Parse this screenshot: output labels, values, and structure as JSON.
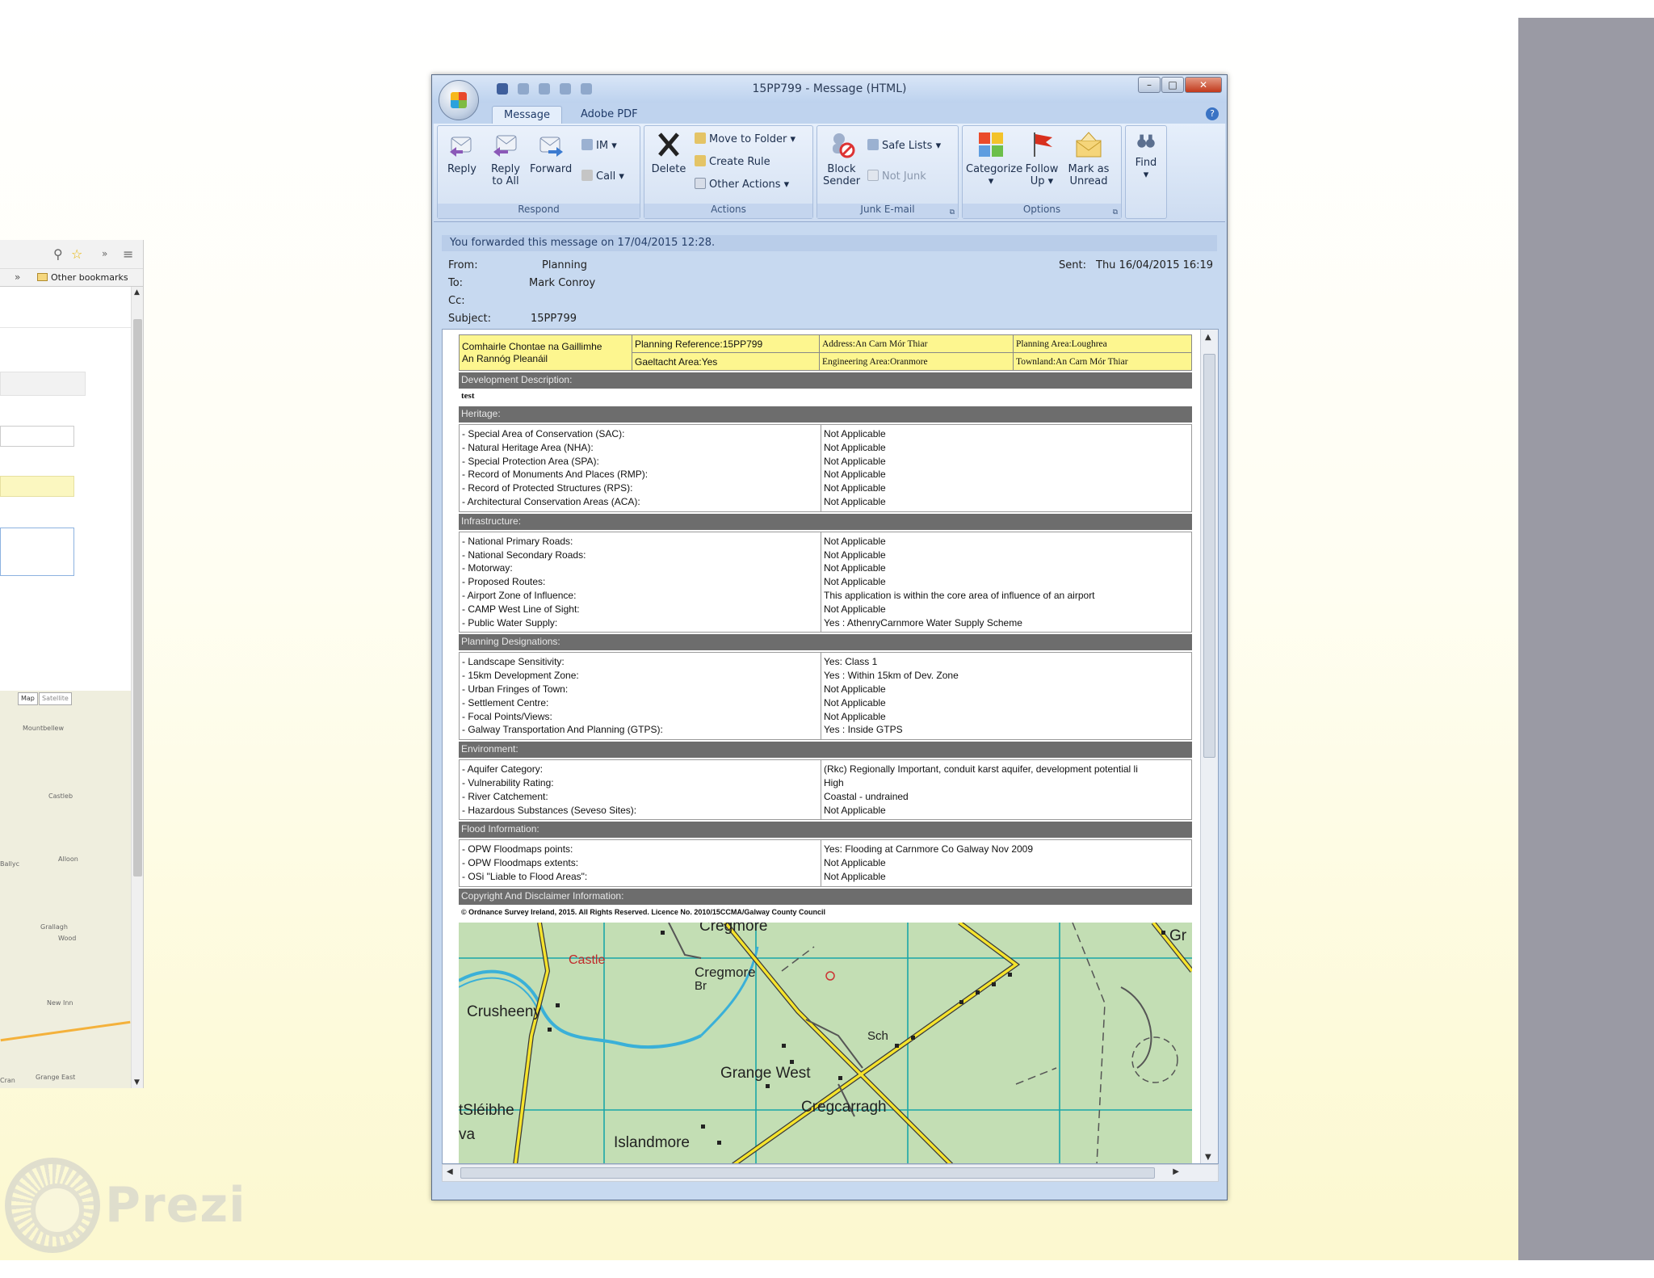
{
  "browser": {
    "other_bookmarks": "Other bookmarks",
    "chevron": "»",
    "map_buttons": [
      "Map",
      "Satellite"
    ],
    "map_labels": [
      "Mountbellew",
      "Castleb",
      "Ballyc",
      "Alloon",
      "Grallagh",
      "Wood",
      "New Inn",
      "Grange East",
      "Cran"
    ]
  },
  "prezi": {
    "word": "Prezi"
  },
  "window": {
    "title": "15PP799 - Message (HTML)",
    "tabs": [
      "Message",
      "Adobe PDF"
    ],
    "ribbon": {
      "respond": {
        "label": "Respond",
        "reply": "Reply",
        "reply_all": "Reply to All",
        "forward": "Forward",
        "im": "IM",
        "call": "Call"
      },
      "actions": {
        "label": "Actions",
        "delete": "Delete",
        "move_to_folder": "Move to Folder",
        "create_rule": "Create Rule",
        "other_actions": "Other Actions"
      },
      "junk": {
        "label": "Junk E-mail",
        "block_sender": "Block Sender",
        "safe_lists": "Safe Lists",
        "not_junk": "Not Junk"
      },
      "options": {
        "label": "Options",
        "categorize": "Categorize",
        "follow_up": "Follow Up",
        "mark_unread": "Mark as Unread"
      },
      "find": {
        "label": "Find"
      }
    },
    "info": "You forwarded this message on 17/04/2015 12:28.",
    "header": {
      "from_label": "From:",
      "from": "Planning",
      "to_label": "To:",
      "to": "Mark Conroy",
      "cc_label": "Cc:",
      "subject_label": "Subject:",
      "subject": "15PP799",
      "sent_label": "Sent:",
      "sent": "Thu 16/04/2015 16:19"
    }
  },
  "email": {
    "top": {
      "org1": "Comhairle Chontae na Gaillimhe",
      "org2": "An Rannóg Pleanáil",
      "planning_ref": "Planning Reference:15PP799",
      "address": "Address:An Carn Mór Thiar",
      "planning_area": "Planning Area:Loughrea",
      "gaeltacht": "Gaeltacht Area:Yes",
      "engineering": "Engineering Area:Oranmore",
      "townland": "Townland:An Carn Mór Thiar"
    },
    "dev_desc_title": "Development Description:",
    "dev_desc": "test",
    "sections": [
      {
        "title": "Heritage:",
        "labels": [
          "- Special Area of Conservation (SAC):",
          "- Natural Heritage Area (NHA):",
          "- Special Protection Area (SPA):",
          "- Record of Monuments And Places (RMP):",
          "- Record of Protected Structures (RPS):",
          "- Architectural Conservation Areas (ACA):"
        ],
        "values": [
          "Not Applicable",
          "Not Applicable",
          "Not Applicable",
          "Not Applicable",
          "Not Applicable",
          "Not Applicable"
        ]
      },
      {
        "title": "Infrastructure:",
        "labels": [
          "- National Primary Roads:",
          "- National Secondary Roads:",
          "- Motorway:",
          "- Proposed Routes:",
          "- Airport Zone of Influence:",
          "- CAMP West Line of Sight:",
          "- Public Water Supply:"
        ],
        "values": [
          "Not Applicable",
          "Not Applicable",
          "Not Applicable",
          "Not Applicable",
          "This application is within the core area of influence of an airport",
          "Not Applicable",
          "Yes : AthenryCarnmore Water Supply Scheme"
        ]
      },
      {
        "title": "Planning Designations:",
        "labels": [
          "- Landscape Sensitivity:",
          "- 15km Development Zone:",
          "- Urban Fringes of Town:",
          "- Settlement Centre:",
          "- Focal Points/Views:",
          "- Galway Transportation And Planning (GTPS):"
        ],
        "values": [
          "Yes: Class 1",
          "Yes : Within 15km of Dev. Zone",
          "Not Applicable",
          "Not Applicable",
          "Not Applicable",
          "Yes : Inside GTPS"
        ]
      },
      {
        "title": "Environment:",
        "labels": [
          "- Aquifer Category:",
          "- Vulnerability Rating:",
          "- River Catchement:",
          "- Hazardous Substances (Seveso Sites):"
        ],
        "values": [
          "(Rkc) Regionally Important, conduit karst aquifer, development potential li",
          "High",
          "Coastal - undrained",
          "Not Applicable"
        ]
      },
      {
        "title": "Flood Information:",
        "labels": [
          "- OPW Floodmaps points:",
          "- OPW Floodmaps extents:",
          "- OSi \"Liable to Flood Areas\":"
        ],
        "values": [
          "Yes: Flooding at Carnmore Co Galway Nov 2009",
          "Not Applicable",
          "Not Applicable"
        ]
      }
    ],
    "copyright_title": "Copyright And Disclaimer Information:",
    "copyright": "© Ordnance Survey Ireland, 2015. All Rights Reserved. Licence No. 2010/15CCMA/Galway County Council",
    "map_labels": {
      "castle": "Castle",
      "cregmore": "Cregmore",
      "br": "Br",
      "crusheeny": "Crusheeny",
      "grange_west": "Grange West",
      "cregcarragh": "Cregcarragh",
      "sleibhe": "tSléibhe",
      "va": "va",
      "islandmore": "Islandmore",
      "cregmore_top": "Cregmore",
      "sch": "Sch",
      "gr": "Gr"
    }
  }
}
